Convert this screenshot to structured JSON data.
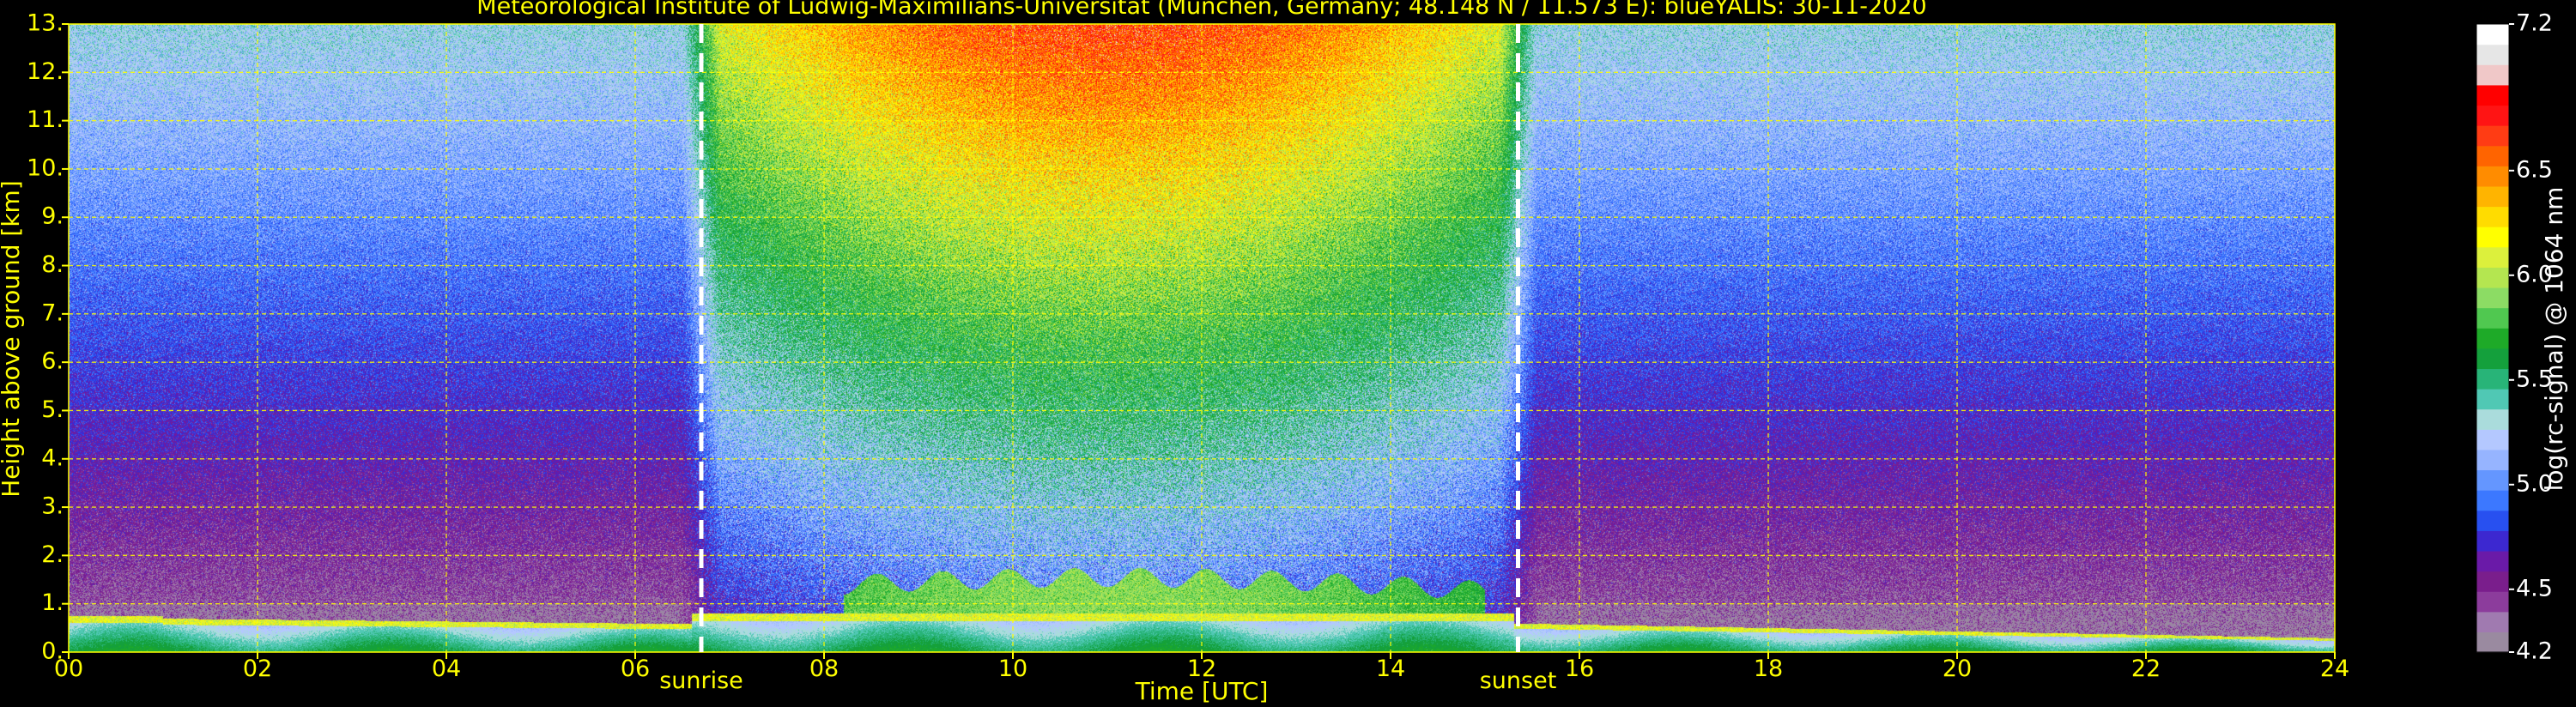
{
  "chart_data": {
    "type": "heatmap",
    "title": "Meteorological Institute of Ludwig-Maximilians-Universität (München, Germany; 48.148 N / 11.573 E):    blueYALIS: 30-11-2020",
    "xlabel": "Time [UTC]",
    "ylabel": "Height above ground [km]",
    "colorbar_label": "log(rc-signal) @ 1064 nm",
    "xlim": [
      0,
      24
    ],
    "ylim": [
      0,
      13
    ],
    "x_ticks": [
      "00",
      "02",
      "04",
      "06",
      "08",
      "10",
      "12",
      "14",
      "16",
      "18",
      "20",
      "22",
      "24"
    ],
    "y_ticks": [
      "0.",
      "1.",
      "2.",
      "3.",
      "4.",
      "5.",
      "6.",
      "7.",
      "8.",
      "9.",
      "10.",
      "11.",
      "12.",
      "13."
    ],
    "colorbar_range": [
      4.2,
      7.2
    ],
    "colorbar_ticks": [
      "4.2",
      "4.5",
      "5.0",
      "5.5",
      "6.0",
      "6.5",
      "7.2"
    ],
    "colorbar_colors": [
      "#9a8aa0",
      "#a07ab0",
      "#8c3c9c",
      "#7a1e8c",
      "#6a1aa8",
      "#3c28d0",
      "#2850f0",
      "#3c78ff",
      "#6496ff",
      "#96b4ff",
      "#b4c8ff",
      "#aadcdc",
      "#50c8b4",
      "#28b478",
      "#14a03c",
      "#1eaa28",
      "#50c850",
      "#8cdc64",
      "#b4e650",
      "#dcf03c",
      "#ffff00",
      "#ffdc00",
      "#ffb400",
      "#ff8c00",
      "#ff6400",
      "#ff3c14",
      "#ff1414",
      "#ff0000",
      "#f0c8c8",
      "#e6e6e6",
      "#ffffff"
    ],
    "grid": true,
    "events": [
      {
        "label": "sunrise",
        "time": 6.7
      },
      {
        "label": "sunset",
        "time": 15.35
      }
    ]
  }
}
